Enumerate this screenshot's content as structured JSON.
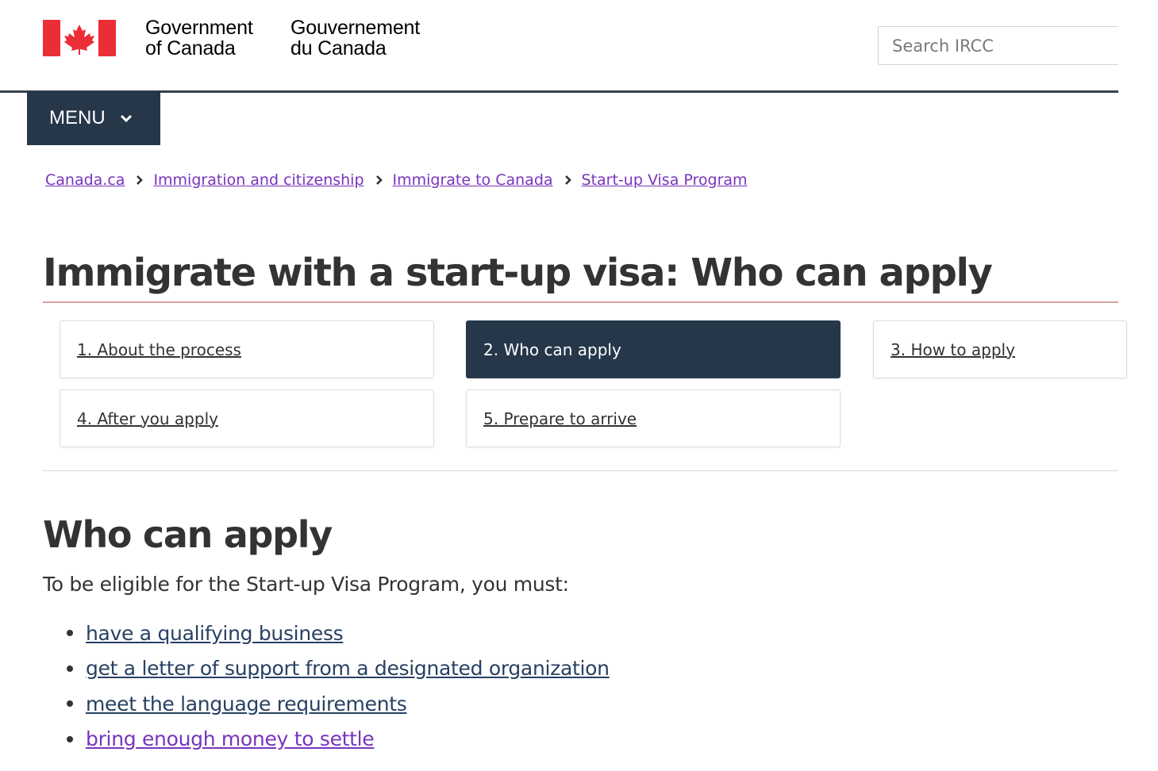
{
  "header": {
    "signature_en_line1": "Government",
    "signature_en_line2": "of Canada",
    "signature_fr_line1": "Gouvernement",
    "signature_fr_line2": "du Canada",
    "search_placeholder": "Search IRCC",
    "flag_icon": "canada-flag-icon",
    "flag_color": "#eb2d37"
  },
  "menu": {
    "label": "MENU",
    "icon": "chevron-down-icon"
  },
  "breadcrumb": [
    {
      "label": "Canada.ca"
    },
    {
      "label": "Immigration and citizenship"
    },
    {
      "label": "Immigrate to Canada"
    },
    {
      "label": "Start-up Visa Program"
    }
  ],
  "page_title": "Immigrate with a start-up visa: Who can apply",
  "steps": [
    {
      "label": "1. About the process",
      "active": false
    },
    {
      "label": "2. Who can apply",
      "active": true
    },
    {
      "label": "3. How to apply",
      "active": false
    },
    {
      "label": "4. After you apply",
      "active": false
    },
    {
      "label": "5. Prepare to arrive",
      "active": false
    }
  ],
  "section": {
    "title": "Who can apply",
    "intro": "To be eligible for the Start-up Visa Program, you must:",
    "requirements": [
      {
        "label": "have a qualifying business"
      },
      {
        "label": "get a letter of support from a designated organization"
      },
      {
        "label": "meet the language requirements"
      },
      {
        "label": "bring enough money to settle"
      }
    ]
  },
  "colors": {
    "nav_dark": "#26374a",
    "link": "#284162",
    "visited_link": "#7834bc",
    "title_rule": "#d9a0a8"
  }
}
